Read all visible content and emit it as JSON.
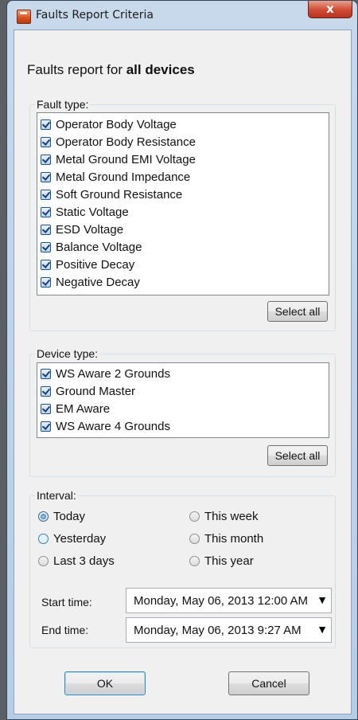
{
  "window": {
    "title": "Faults Report Criteria",
    "close_glyph": "x",
    "icon": "report-app-icon"
  },
  "heading": {
    "prefix": "Faults report for ",
    "bold": "all devices"
  },
  "fault_type": {
    "label": "Fault type:",
    "items": [
      {
        "label": "Operator Body Voltage",
        "checked": true
      },
      {
        "label": "Operator Body Resistance",
        "checked": true
      },
      {
        "label": "Metal Ground EMI Voltage",
        "checked": true
      },
      {
        "label": "Metal Ground Impedance",
        "checked": true
      },
      {
        "label": "Soft Ground Resistance",
        "checked": true
      },
      {
        "label": "Static Voltage",
        "checked": true
      },
      {
        "label": "ESD Voltage",
        "checked": true
      },
      {
        "label": "Balance Voltage",
        "checked": true
      },
      {
        "label": "Positive Decay",
        "checked": true
      },
      {
        "label": "Negative Decay",
        "checked": true
      }
    ],
    "select_all": "Select all"
  },
  "device_type": {
    "label": "Device type:",
    "items": [
      {
        "label": "WS Aware 2 Grounds",
        "checked": true
      },
      {
        "label": "Ground Master",
        "checked": true
      },
      {
        "label": "EM Aware",
        "checked": true
      },
      {
        "label": "WS Aware 4 Grounds",
        "checked": true
      }
    ],
    "select_all": "Select all"
  },
  "interval": {
    "label": "Interval:",
    "options": {
      "today": "Today",
      "yesterday": "Yesterday",
      "last3": "Last 3 days",
      "week": "This week",
      "month": "This month",
      "year": "This year"
    },
    "selected": "Today",
    "start_label": "Start time:",
    "start_value": "Monday, May 06, 2013 12:00 AM",
    "end_label": "End time:",
    "end_value": "Monday, May 06, 2013 9:27 AM",
    "dropdown_glyph": "▼"
  },
  "actions": {
    "ok": "OK",
    "cancel": "Cancel"
  }
}
